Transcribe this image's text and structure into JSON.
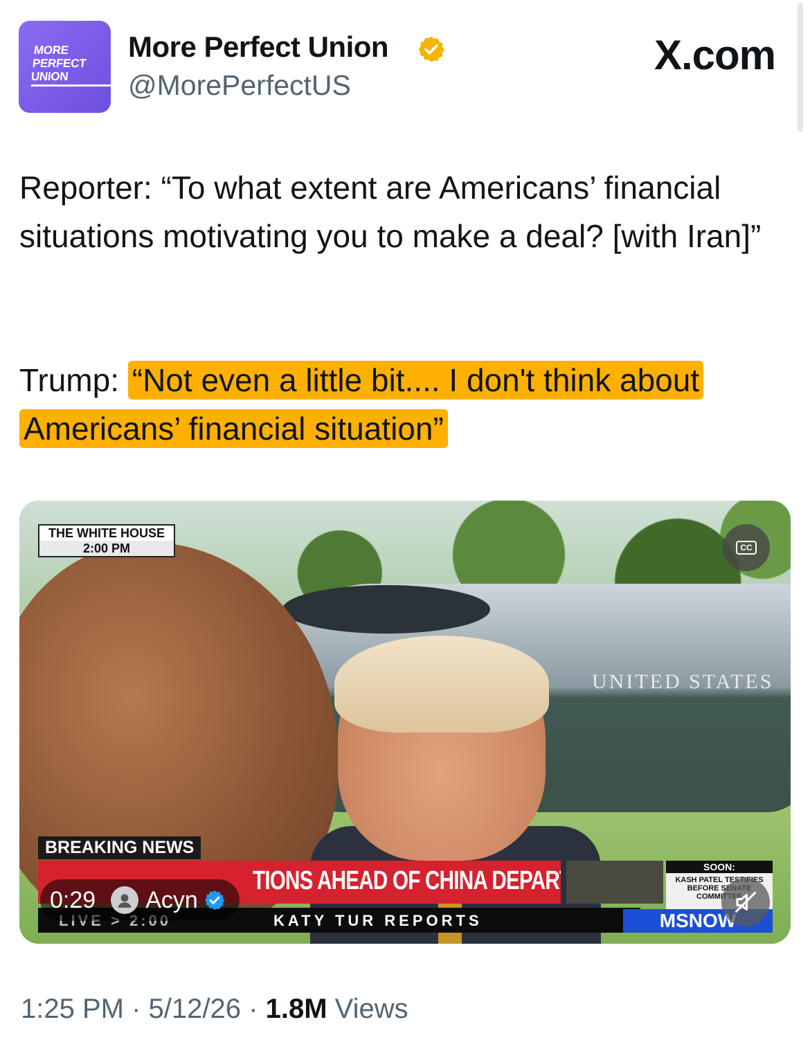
{
  "profile": {
    "avatar_lines": [
      "MORE",
      "PERFECT",
      "UNION"
    ],
    "display_name": "More Perfect Union",
    "handle": "@MorePerfectUS",
    "site": "X.com",
    "verified_color": "#f4b400"
  },
  "tweet": {
    "para1": "Reporter: “To what extent are Americans’ financial situations motivating you to make a deal? [with Iran]”",
    "para2_prefix": "Trump: ",
    "para2_highlight": "“Not even a little bit.... I don't think about Americans’ financial situation”",
    "highlight_color": "#ffb000"
  },
  "video": {
    "location_tag": "THE WHITE HOUSE",
    "time_tag": "2:00 PM",
    "cc_label": "CC",
    "heli_text": "UNITED STATES",
    "breaking": "BREAKING NEWS",
    "headline": "TIONS AHEAD OF CHINA DEPARTURE",
    "soon_head": "SOON:",
    "soon_body": "KASH PATEL TESTIFIES BEFORE SENATE COMMITTEE",
    "live": "LIVE > 2:00",
    "show": "KATY TUR REPORTS",
    "network": "MSNOW",
    "duration": "0:29",
    "uploader": "Acyn",
    "muted": true
  },
  "footer": {
    "time": "1:25 PM",
    "date": "5/12/26",
    "views_count": "1.8M",
    "views_label": "Views",
    "sep": "·"
  }
}
